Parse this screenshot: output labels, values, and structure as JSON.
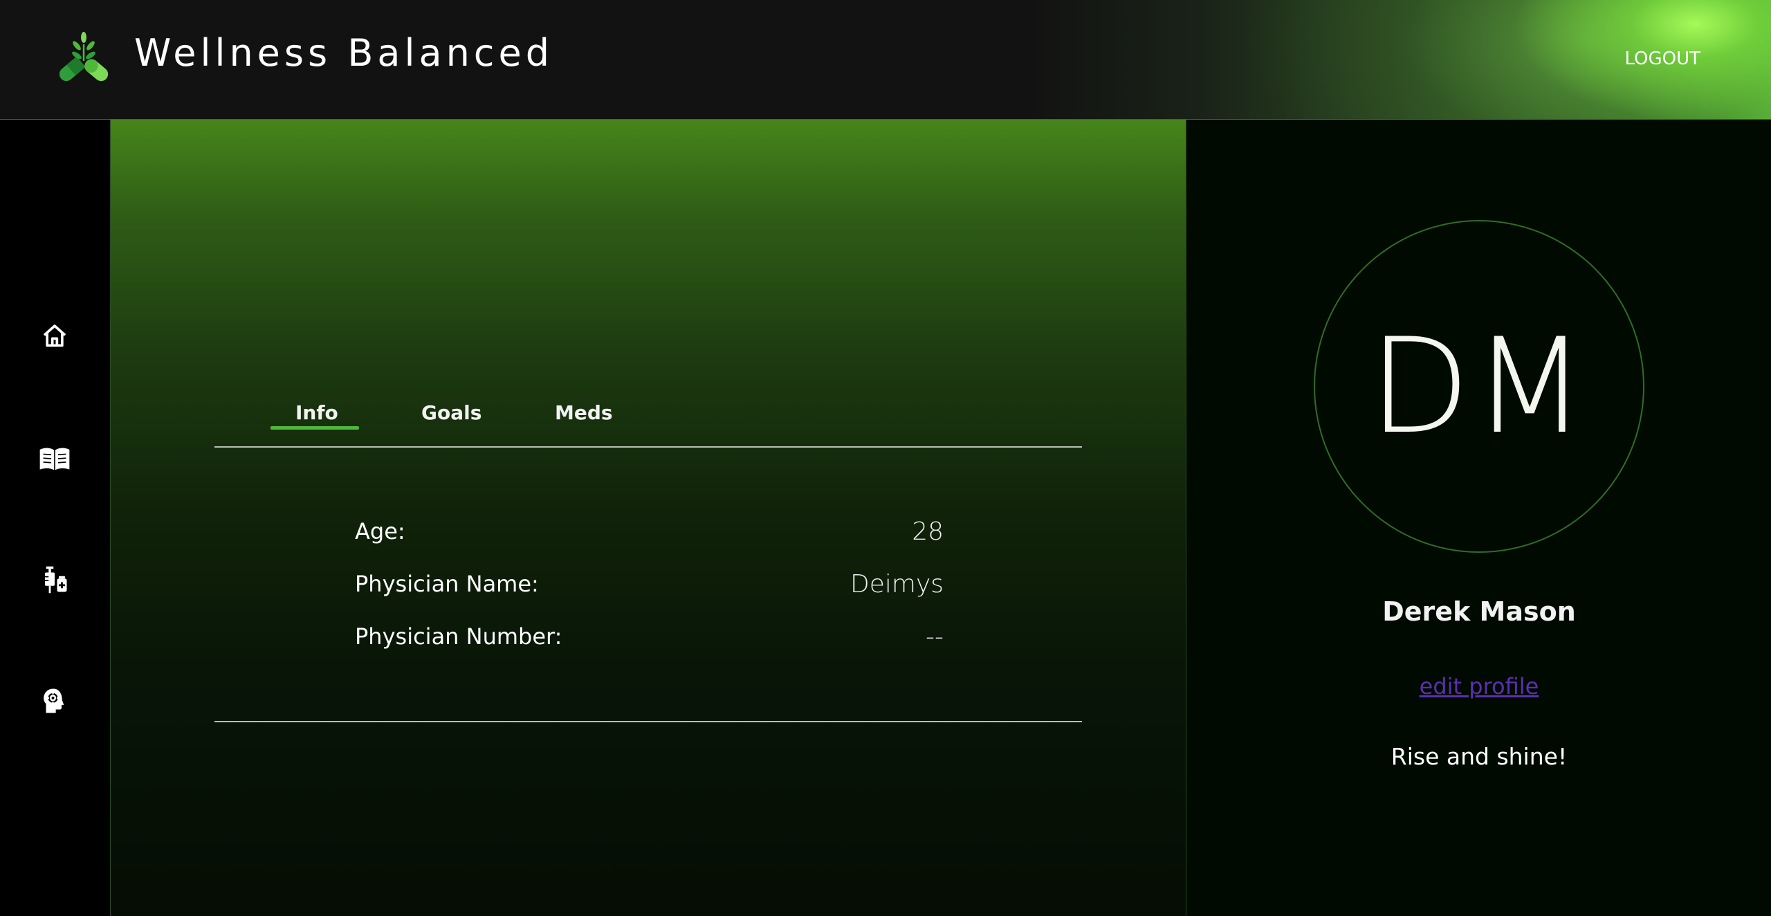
{
  "header": {
    "app_title": "Wellness Balanced",
    "logo_icon": "leaf-pill-logo-icon",
    "logout_label": "LOGOUT"
  },
  "sidebar": {
    "items": [
      {
        "icon": "home-icon"
      },
      {
        "icon": "book-icon"
      },
      {
        "icon": "syringe-medicine-icon"
      },
      {
        "icon": "mind-settings-icon"
      }
    ]
  },
  "main": {
    "tabs": [
      {
        "label": "Info",
        "active": true
      },
      {
        "label": "Goals",
        "active": false
      },
      {
        "label": "Meds",
        "active": false
      }
    ],
    "info": [
      {
        "label": "Age:",
        "value": "28"
      },
      {
        "label": "Physician Name:",
        "value": "Deimys"
      },
      {
        "label": "Physician Number:",
        "value": "--"
      }
    ]
  },
  "profile": {
    "initials": "DM",
    "name": "Derek Mason",
    "edit_label": "edit profile",
    "greeting": "Rise and shine!"
  },
  "colors": {
    "accent": "#4fb83a",
    "link": "#5b2fb0"
  }
}
